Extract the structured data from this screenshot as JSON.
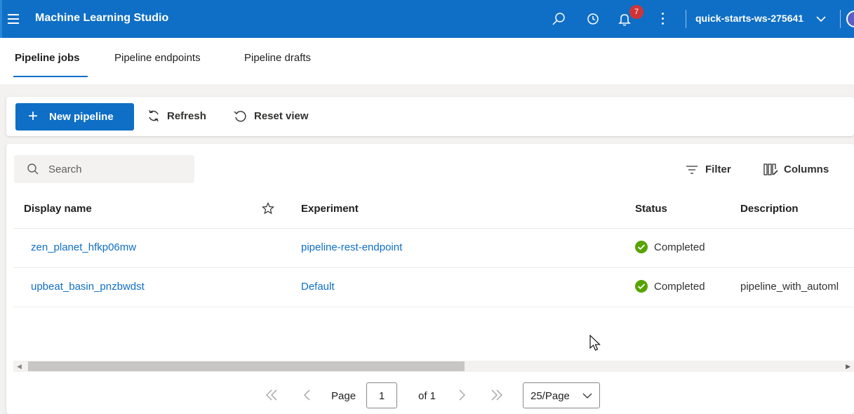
{
  "header": {
    "app_title": "Machine Learning Studio",
    "notification_count": "7",
    "workspace": "quick-starts-ws-275641",
    "icons": [
      "hamburger-icon",
      "search-icon",
      "clock-icon",
      "bell-icon",
      "more-icon",
      "chevron-down-icon"
    ]
  },
  "tabs": [
    {
      "label": "Pipeline jobs",
      "active": true
    },
    {
      "label": "Pipeline endpoints",
      "active": false
    },
    {
      "label": "Pipeline drafts",
      "active": false
    }
  ],
  "toolbar": {
    "new_pipeline": "New pipeline",
    "refresh": "Refresh",
    "reset_view": "Reset view"
  },
  "list": {
    "search_placeholder": "Search",
    "filter": "Filter",
    "columns": "Columns",
    "headers": {
      "display_name": "Display name",
      "experiment": "Experiment",
      "status": "Status",
      "description": "Description"
    },
    "rows": [
      {
        "display_name": "zen_planet_hfkp06mw",
        "experiment": "pipeline-rest-endpoint",
        "status": "Completed",
        "description": ""
      },
      {
        "display_name": "upbeat_basin_pnzbwdst",
        "experiment": "Default",
        "status": "Completed",
        "description": "pipeline_with_automl"
      }
    ]
  },
  "pagination": {
    "page_label": "Page",
    "current_page": "1",
    "of_label": "of 1",
    "page_size": "25/Page"
  },
  "colors": {
    "brand": "#0f6fc6",
    "status_completed": "#57a300",
    "badge": "#d13438"
  }
}
